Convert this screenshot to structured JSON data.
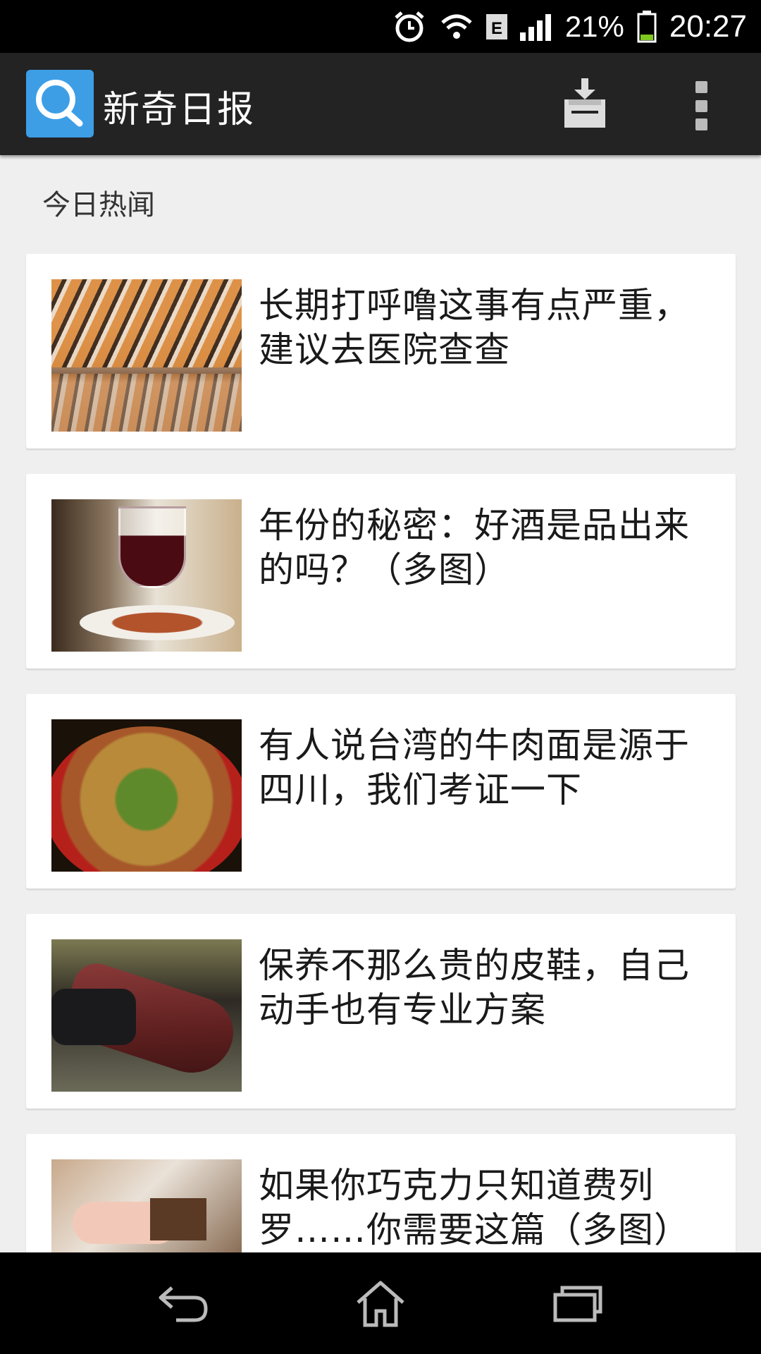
{
  "status_bar": {
    "icons": [
      "alarm-icon",
      "wifi-icon",
      "edge-network-icon",
      "signal-icon",
      "battery-icon"
    ],
    "network_type": "E",
    "battery_percent": "21%",
    "time": "20:27",
    "battery_color": "#7ec820"
  },
  "app_bar": {
    "title": "新奇日报",
    "logo_color": "#3d9ee6",
    "actions": [
      "download-icon",
      "overflow-menu-icon"
    ]
  },
  "section_title": "今日热闻",
  "articles": [
    {
      "headline": "长期打呼噜这事有点严重，建议去医院查查",
      "thumbnail": "tiger-image"
    },
    {
      "headline": "年份的秘密：好酒是品出来的吗？（多图）",
      "thumbnail": "wine-image"
    },
    {
      "headline": "有人说台湾的牛肉面是源于四川，我们考证一下",
      "thumbnail": "beef-noodle-image"
    },
    {
      "headline": "保养不那么贵的皮鞋，自己动手也有专业方案",
      "thumbnail": "leather-shoe-image"
    },
    {
      "headline": "如果你巧克力只知道费列罗……你需要这篇（多图）",
      "thumbnail": "chocolate-image"
    }
  ],
  "nav_bar": {
    "buttons": [
      "back-icon",
      "home-icon",
      "recent-apps-icon"
    ]
  }
}
